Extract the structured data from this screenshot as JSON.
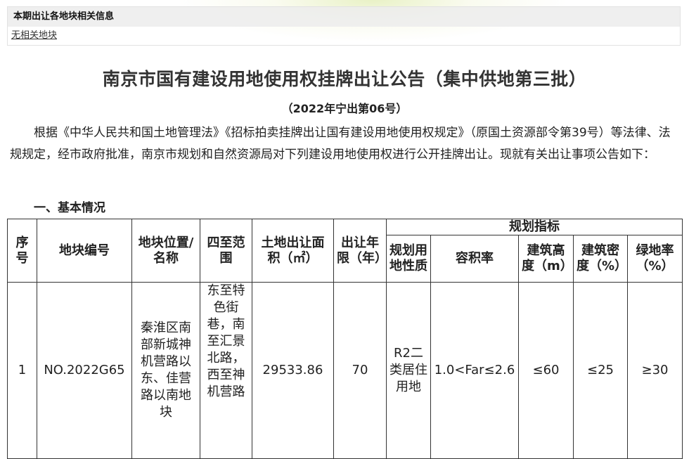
{
  "info_panel": {
    "header": "本期出让各地块相关信息",
    "link_text": "无相关地块"
  },
  "document": {
    "title": "南京市国有建设用地使用权挂牌出让公告（集中供地第三批）",
    "subtitle": "（2022年宁出第06号）",
    "intro": "根据《中华人民共和国土地管理法》《招标拍卖挂牌出让国有建设用地使用权规定》（原国土资源部令第39号）等法律、法规规定，经市政府批准，南京市规划和自然资源局对下列建设用地使用权进行公开挂牌出让。现就有关出让事项公告如下：",
    "section_heading": "一、基本情况"
  },
  "table": {
    "headers": {
      "seq": "序号",
      "plot_no": "地块编号",
      "location": "地块位置/名称",
      "boundary": "四至范围",
      "area": "土地出让面积（㎡）",
      "term": "出让年限（年）",
      "planning_group": "规划指标",
      "land_use": "规划用地性质",
      "far": "容积率",
      "height": "建筑高度（m）",
      "density": "建筑密度（%）",
      "green": "绿地率（%）"
    },
    "rows": [
      {
        "seq": "1",
        "plot_no": "NO.2022G65",
        "location": "秦淮区南部新城神机营路以东、佳营路以南地块",
        "boundary": "东至特色街巷，南至汇景北路，西至神机营路",
        "area": "29533.86",
        "term": "70",
        "land_use": "R2二类居住用地",
        "far": "1.0<Far≤2.6",
        "height": "≤60",
        "density": "≤25",
        "green": "≥30"
      }
    ]
  }
}
